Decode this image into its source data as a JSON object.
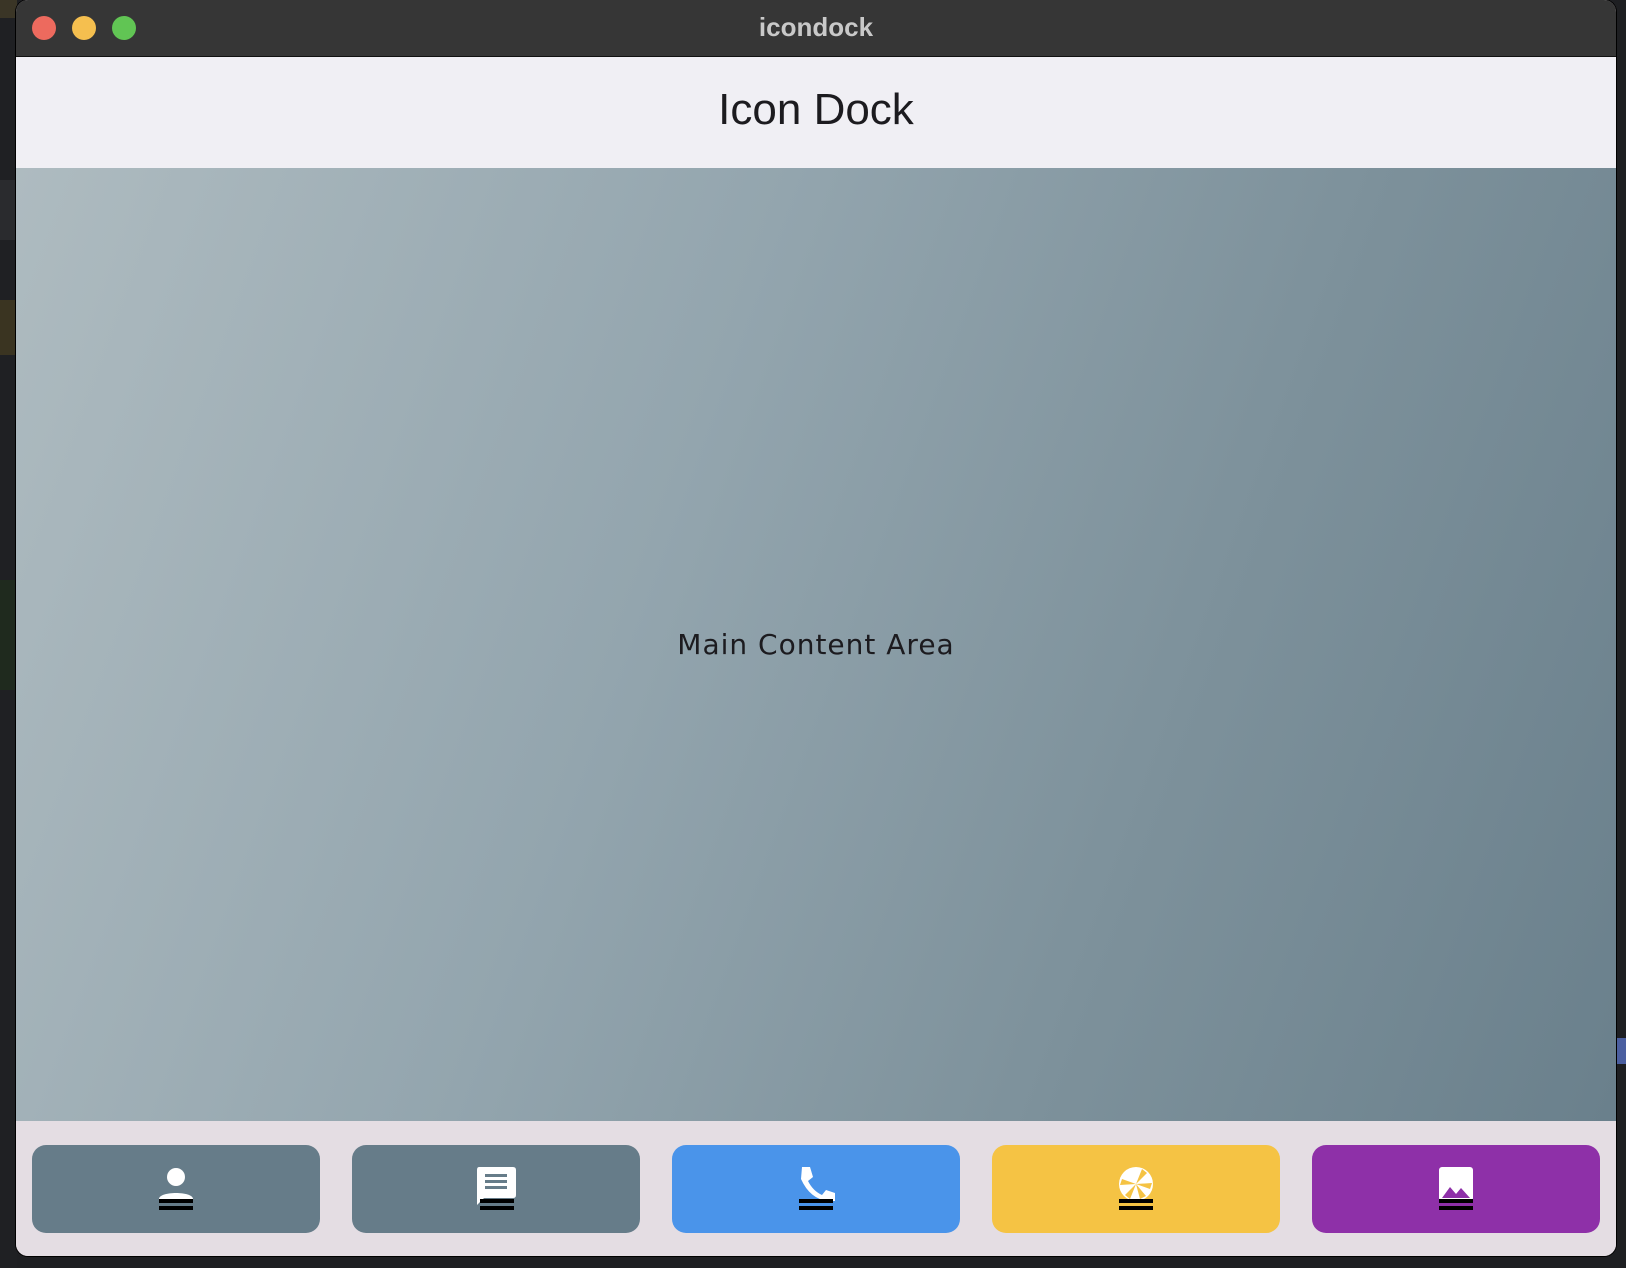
{
  "window": {
    "title": "icondock"
  },
  "appbar": {
    "title": "Icon Dock"
  },
  "main": {
    "label": "Main Content Area"
  },
  "dock": {
    "items": [
      {
        "icon": "person-icon",
        "color": "#667c89"
      },
      {
        "icon": "message-icon",
        "color": "#667c89"
      },
      {
        "icon": "phone-icon",
        "color": "#4a94ea"
      },
      {
        "icon": "camera-shutter-icon",
        "color": "#f5c344"
      },
      {
        "icon": "image-icon",
        "color": "#8e30a8"
      }
    ]
  },
  "colors": {
    "titlebar": "#363636",
    "appbar": "#f0eff4",
    "dock_background": "#e4dde3",
    "content_gradient_start": "#aebbc0",
    "content_gradient_end": "#6a808c"
  }
}
